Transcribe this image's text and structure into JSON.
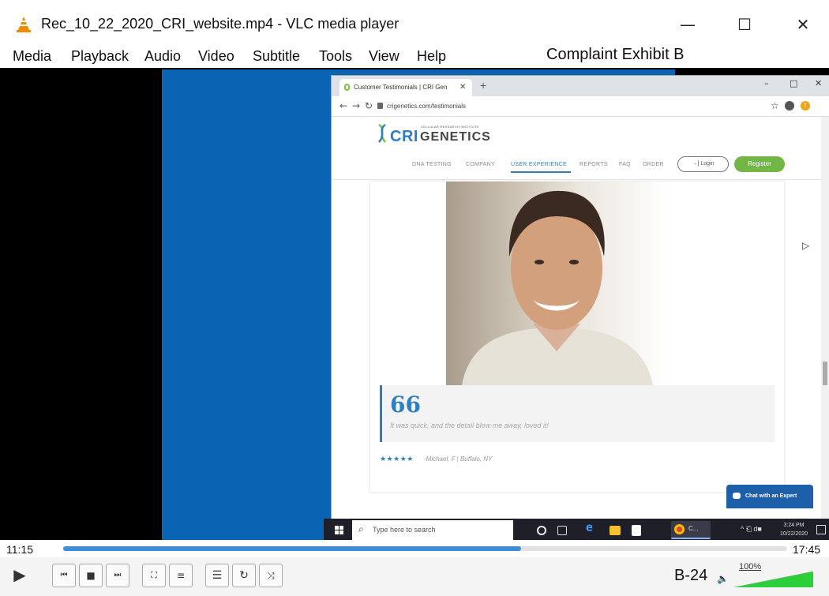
{
  "window": {
    "title": "Rec_10_22_2020_CRI_website.mp4 - VLC media player"
  },
  "menu": {
    "items": [
      "Media",
      "Playback",
      "Audio",
      "Video",
      "Subtitle",
      "Tools",
      "View",
      "Help"
    ]
  },
  "overlay": {
    "exhibit_caption": "Complaint Exhibit B",
    "exhibit_number": "B-24"
  },
  "browser": {
    "tab_title": "Customer Testimonials | CRI Gen",
    "url": "crigenetics.com/testimonials"
  },
  "site": {
    "logo_cri": "CRI",
    "logo_genetics": "GENETICS",
    "logo_tagline": "CELLULAR RESEARCH INSTITUTE",
    "nav": [
      "DNA TESTING",
      "COMPANY",
      "USER EXPERIENCE",
      "REPORTS",
      "FAQ",
      "ORDER"
    ],
    "active_nav": "USER EXPERIENCE",
    "login_label": "→] Login",
    "register_label": "Register",
    "quote_mark": "66",
    "quote_text": "It was quick, and the detail blew me away, loved it!",
    "stars": "★★★★★",
    "rating": 5,
    "attribution": "-Michael, F | Buffalo, NY",
    "chat_label": "Chat with an Expert"
  },
  "taskbar": {
    "search_placeholder": "Type here to search",
    "tray": "^ ⎗ d■",
    "time": "3:24 PM",
    "date": "10/22/2020",
    "chrome_label": "C..."
  },
  "player": {
    "elapsed": "11:15",
    "total": "17:45",
    "progress": 0.633,
    "volume_label": "100%",
    "volume": 1.0
  },
  "colors": {
    "accent_blue": "#2d7fc1",
    "register_green": "#72b746",
    "seek_fill": "#3d8ed6",
    "chat_blue": "#1d5fa8",
    "vlc_orange": "#f08a00"
  }
}
